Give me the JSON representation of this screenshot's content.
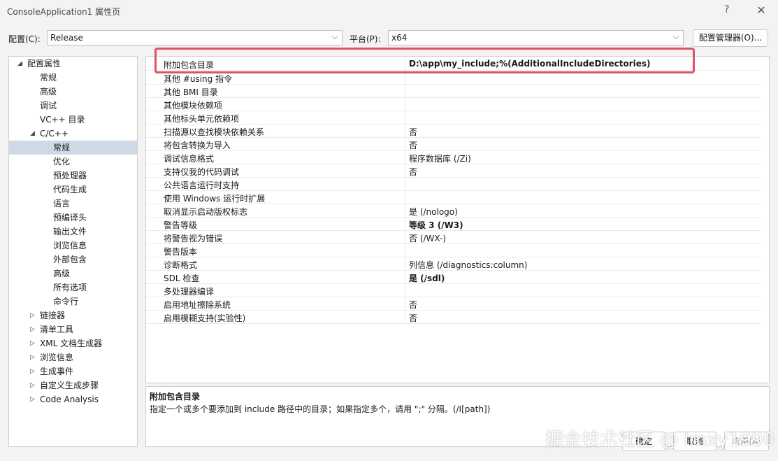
{
  "window": {
    "title": "ConsoleApplication1 属性页",
    "help": "?",
    "close": "✕"
  },
  "toolbar": {
    "config_label": "配置(C):",
    "config_value": "Release",
    "platform_label": "平台(P):",
    "platform_value": "x64",
    "config_manager": "配置管理器(O)..."
  },
  "tree": {
    "items": [
      {
        "label": "配置属性",
        "arrow": "◢"
      },
      {
        "label": "常规"
      },
      {
        "label": "高级"
      },
      {
        "label": "调试"
      },
      {
        "label": "VC++ 目录"
      },
      {
        "label": "C/C++",
        "arrow": "◢"
      },
      {
        "label": "常规",
        "selected": true
      },
      {
        "label": "优化"
      },
      {
        "label": "预处理器"
      },
      {
        "label": "代码生成"
      },
      {
        "label": "语言"
      },
      {
        "label": "预编译头"
      },
      {
        "label": "输出文件"
      },
      {
        "label": "浏览信息"
      },
      {
        "label": "外部包含"
      },
      {
        "label": "高级"
      },
      {
        "label": "所有选项"
      },
      {
        "label": "命令行"
      },
      {
        "label": "链接器",
        "arrow": "▷"
      },
      {
        "label": "清单工具",
        "arrow": "▷"
      },
      {
        "label": "XML 文档生成器",
        "arrow": "▷"
      },
      {
        "label": "浏览信息",
        "arrow": "▷"
      },
      {
        "label": "生成事件",
        "arrow": "▷"
      },
      {
        "label": "自定义生成步骤",
        "arrow": "▷"
      },
      {
        "label": "Code Analysis",
        "arrow": "▷"
      }
    ]
  },
  "grid": {
    "rows": [
      {
        "name": "附加包含目录",
        "value": "D:\\app\\my_include;%(AdditionalIncludeDirectories)",
        "bold": true
      },
      {
        "name": "其他 #using 指令",
        "value": ""
      },
      {
        "name": "其他 BMI 目录",
        "value": ""
      },
      {
        "name": "其他模块依赖项",
        "value": ""
      },
      {
        "name": "其他标头单元依赖项",
        "value": ""
      },
      {
        "name": "扫描源以查找模块依赖关系",
        "value": "否"
      },
      {
        "name": "将包含转换为导入",
        "value": "否"
      },
      {
        "name": "调试信息格式",
        "value": "程序数据库 (/Zi)"
      },
      {
        "name": "支持仅我的代码调试",
        "value": "否"
      },
      {
        "name": "公共语言运行时支持",
        "value": ""
      },
      {
        "name": "使用 Windows 运行时扩展",
        "value": ""
      },
      {
        "name": "取消显示启动版权标志",
        "value": "是 (/nologo)"
      },
      {
        "name": "警告等级",
        "value": "等级 3 (/W3)",
        "bold": true
      },
      {
        "name": "将警告视为错误",
        "value": "否 (/WX-)"
      },
      {
        "name": "警告版本",
        "value": ""
      },
      {
        "name": "诊断格式",
        "value": "列信息 (/diagnostics:column)"
      },
      {
        "name": "SDL 检查",
        "value": "是 (/sdl)",
        "bold": true
      },
      {
        "name": "多处理器编译",
        "value": ""
      },
      {
        "name": "启用地址擦除系统",
        "value": "否"
      },
      {
        "name": "启用模糊支持(实验性)",
        "value": "否"
      }
    ]
  },
  "description": {
    "title": "附加包含目录",
    "text": "指定一个或多个要添加到 include 路径中的目录；如果指定多个，请用 \";\" 分隔。(/I[path])"
  },
  "buttons": {
    "ok": "确定",
    "cancel": "取消",
    "apply": "应用(A)"
  },
  "watermark": "掘金技术社区 @ lmxy1990",
  "colors": {
    "highlight": "#e0516a",
    "selected": "#cfd9e6"
  }
}
